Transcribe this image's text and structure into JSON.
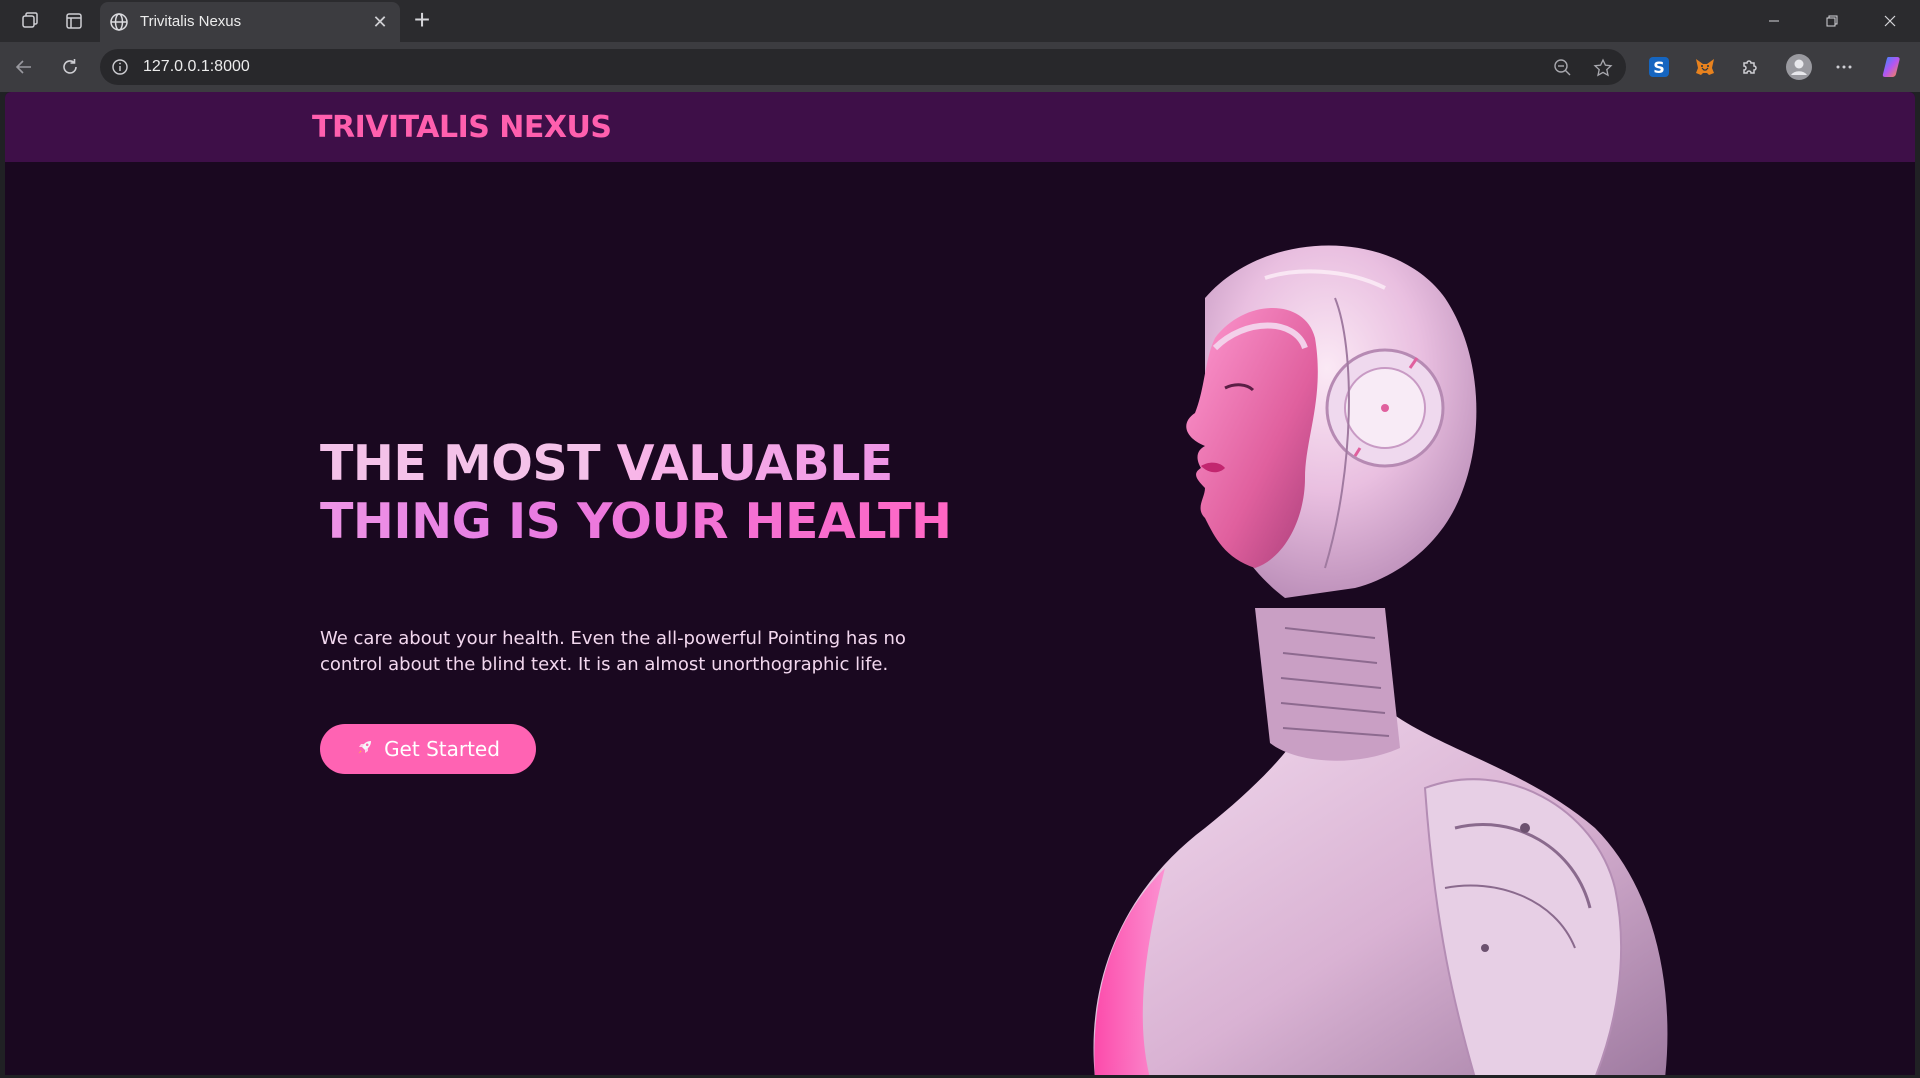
{
  "browser": {
    "tab_title": "Trivitalis Nexus",
    "url": "127.0.0.1:8000",
    "accent": "#3c3c40"
  },
  "site": {
    "brand": "TRIVITALIS NEXUS",
    "hero": {
      "title_part1": "THE MOST ",
      "title_part2": "VALUABLE THING IS YOUR HEALTH",
      "description": "We care about your health. Even the all-powerful Pointing has no control about the blind text. It is an almost unorthographic life.",
      "cta_label": "Get Started",
      "cta_icon": "rocket-icon"
    },
    "colors": {
      "header_bg": "#3e0f48",
      "page_bg": "#1a0820",
      "brand": "#ff5fae",
      "cta_bg": "#ff63b3"
    },
    "image": "robot-woman-illustration"
  }
}
